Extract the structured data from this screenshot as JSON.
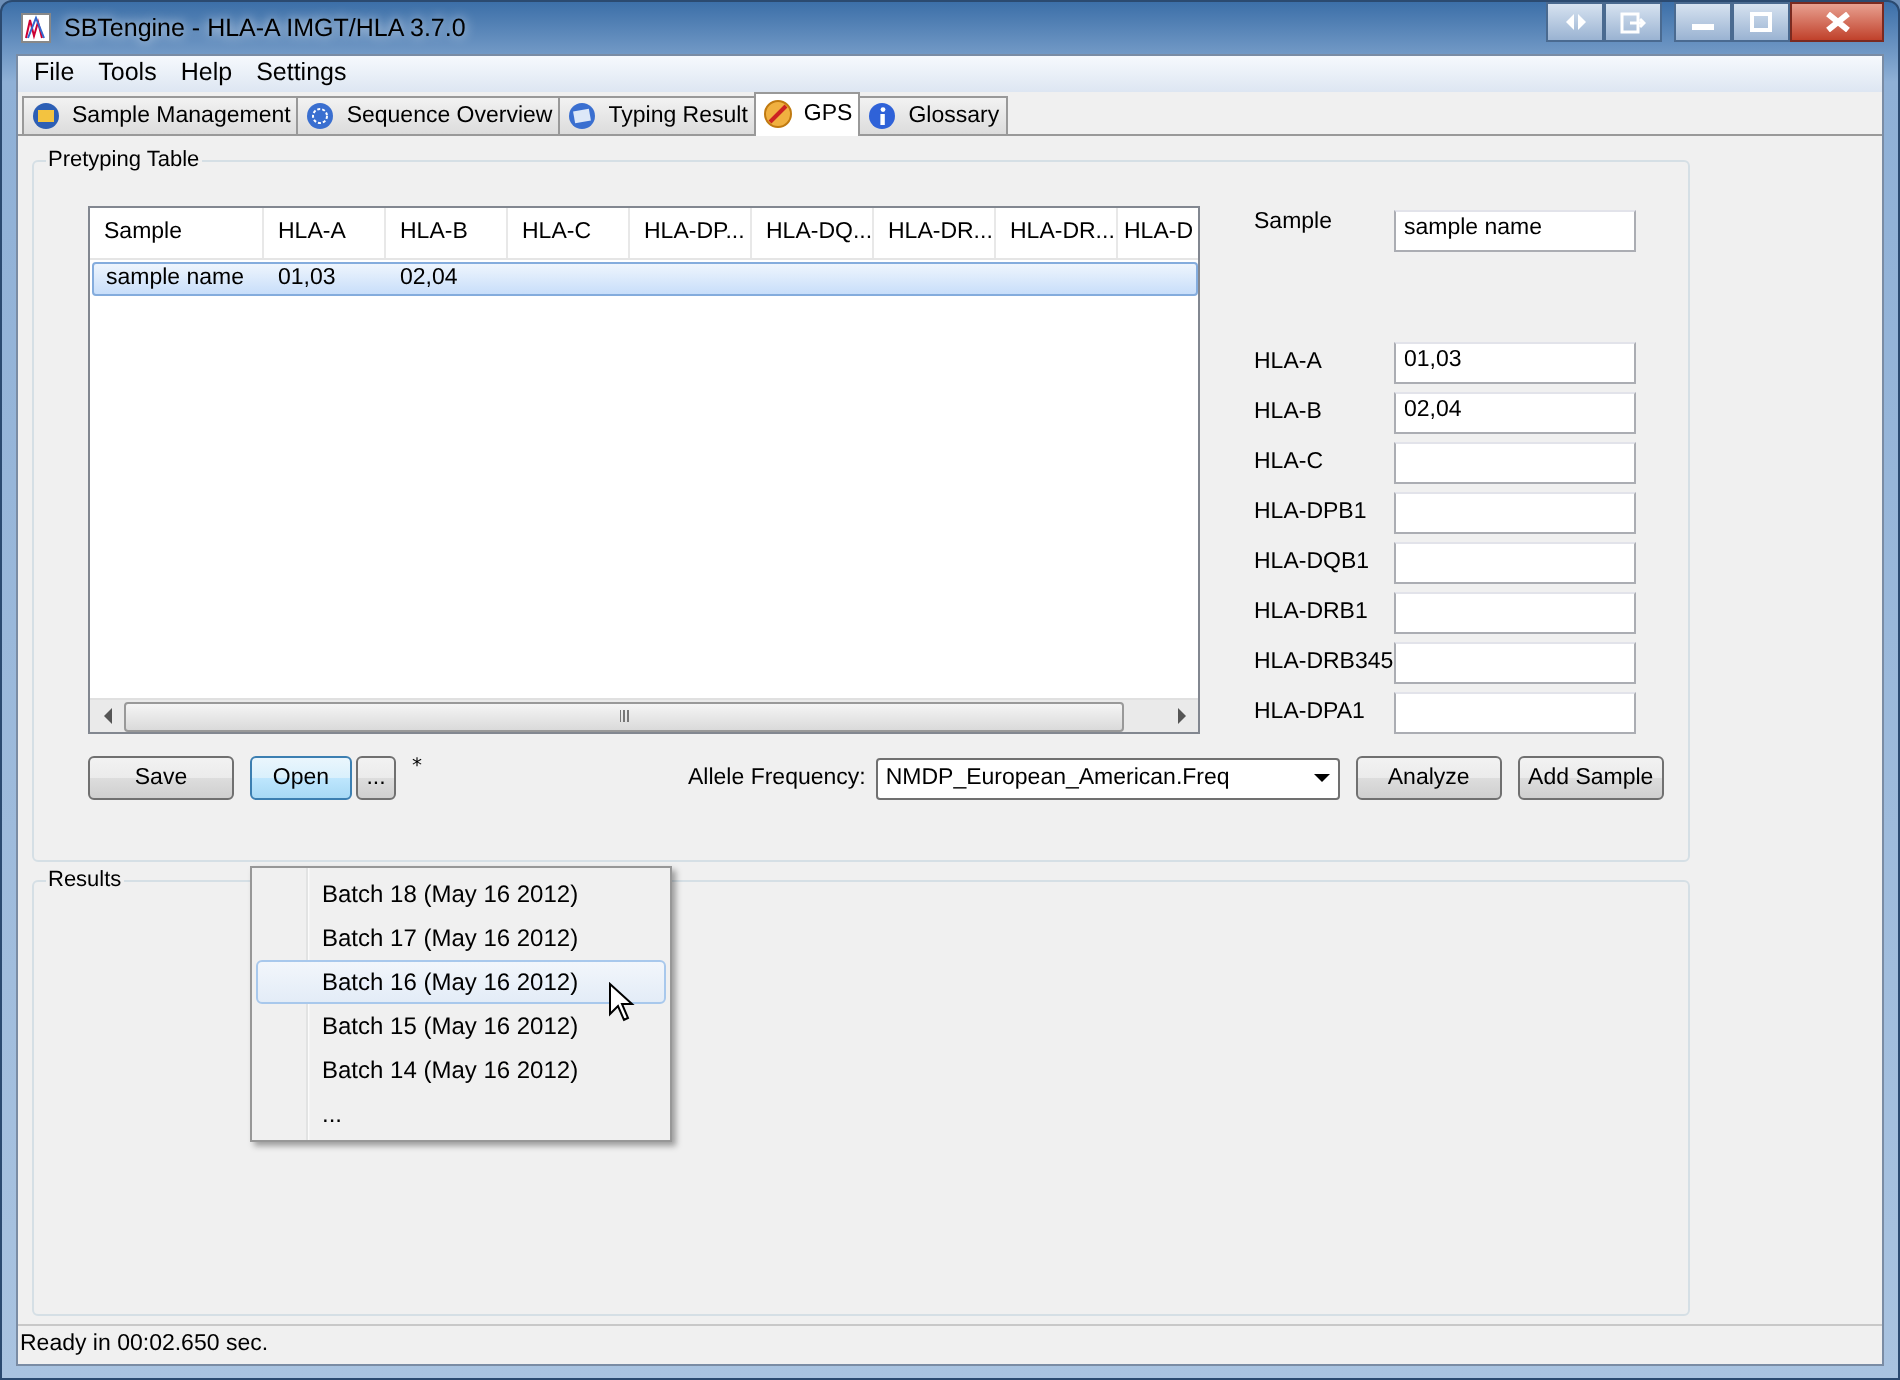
{
  "window": {
    "title": "SBTengine - HLA-A IMGT/HLA 3.7.0"
  },
  "menu": [
    "File",
    "Tools",
    "Help",
    "Settings"
  ],
  "tabs": [
    {
      "label": "Sample Management",
      "selected": false,
      "kind": "samples"
    },
    {
      "label": "Sequence Overview",
      "selected": false,
      "kind": "sequence"
    },
    {
      "label": "Typing Result",
      "selected": false,
      "kind": "result"
    },
    {
      "label": "GPS",
      "selected": true,
      "kind": "gps"
    },
    {
      "label": "Glossary",
      "selected": false,
      "kind": "info"
    }
  ],
  "pretyping": {
    "title": "Pretyping Table",
    "table": {
      "columns": [
        "Sample",
        "HLA-A",
        "HLA-B",
        "HLA-C",
        "HLA-DP...",
        "HLA-DQ...",
        "HLA-DR...",
        "HLA-DR...",
        "HLA-D"
      ],
      "rows": [
        {
          "cells": [
            "sample name",
            "01,03",
            "02,04",
            null,
            null,
            null,
            null,
            null,
            null
          ],
          "selected": true
        }
      ]
    },
    "sample": {
      "label": "Sample",
      "value": "sample name"
    },
    "fields": [
      {
        "label": "HLA-A",
        "value": "01,03"
      },
      {
        "label": "HLA-B",
        "value": "02,04"
      },
      {
        "label": "HLA-C"
      },
      {
        "label": "HLA-DPB1"
      },
      {
        "label": "HLA-DQB1"
      },
      {
        "label": "HLA-DRB1"
      },
      {
        "label": "HLA-DRB345"
      },
      {
        "label": "HLA-DPA1"
      }
    ],
    "save": "Save",
    "open": "Open",
    "more": "...",
    "modified": "*",
    "allele_label": "Allele Frequency:",
    "allele_value": "NMDP_European_American.Freq",
    "analyze": "Analyze",
    "add_sample": "Add Sample"
  },
  "open_menu": [
    {
      "label": "Batch 18 (May 16 2012)",
      "selected": false
    },
    {
      "label": "Batch 17 (May 16 2012)",
      "selected": false
    },
    {
      "label": "Batch 16 (May 16 2012)",
      "selected": true
    },
    {
      "label": "Batch 15 (May 16 2012)",
      "selected": false
    },
    {
      "label": "Batch 14 (May 16 2012)",
      "selected": false
    },
    {
      "label": "...",
      "selected": false
    }
  ],
  "results": {
    "title": "Results"
  },
  "status_bar": "Ready in 00:02.650 sec."
}
